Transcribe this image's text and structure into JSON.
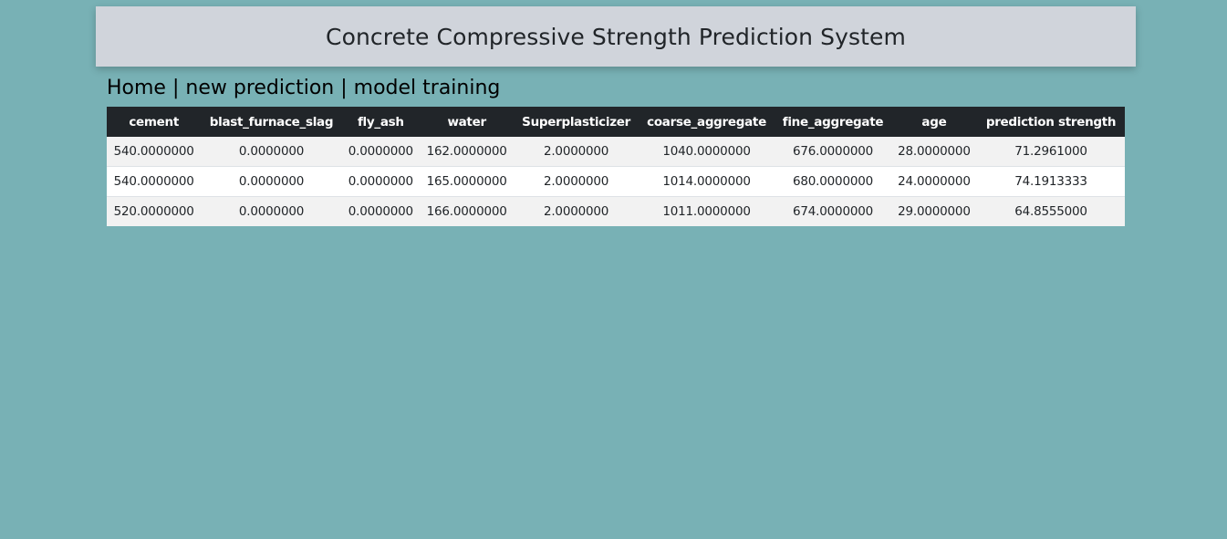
{
  "header": {
    "title": "Concrete Compressive Strength Prediction System"
  },
  "nav": {
    "home": "Home",
    "separator": "|",
    "new_prediction": "new prediction",
    "model_training": "model training"
  },
  "table": {
    "columns": [
      "cement",
      "blast_furnace_slag",
      "fly_ash",
      "water",
      "Superplasticizer",
      "coarse_aggregate",
      "fine_aggregate",
      "age",
      "prediction strength"
    ],
    "rows": [
      [
        "540.0000000",
        "0.0000000",
        "0.0000000",
        "162.0000000",
        "2.0000000",
        "1040.0000000",
        "676.0000000",
        "28.0000000",
        "71.2961000"
      ],
      [
        "540.0000000",
        "0.0000000",
        "0.0000000",
        "165.0000000",
        "2.0000000",
        "1014.0000000",
        "680.0000000",
        "24.0000000",
        "74.1913333"
      ],
      [
        "520.0000000",
        "0.0000000",
        "0.0000000",
        "166.0000000",
        "2.0000000",
        "1011.0000000",
        "674.0000000",
        "29.0000000",
        "64.8555000"
      ]
    ]
  },
  "colors": {
    "page_background": "#78b1b5",
    "header_background": "#d0d4db",
    "table_header_background": "#212529",
    "row_striped": "#f2f2f2",
    "row_plain": "#ffffff"
  }
}
